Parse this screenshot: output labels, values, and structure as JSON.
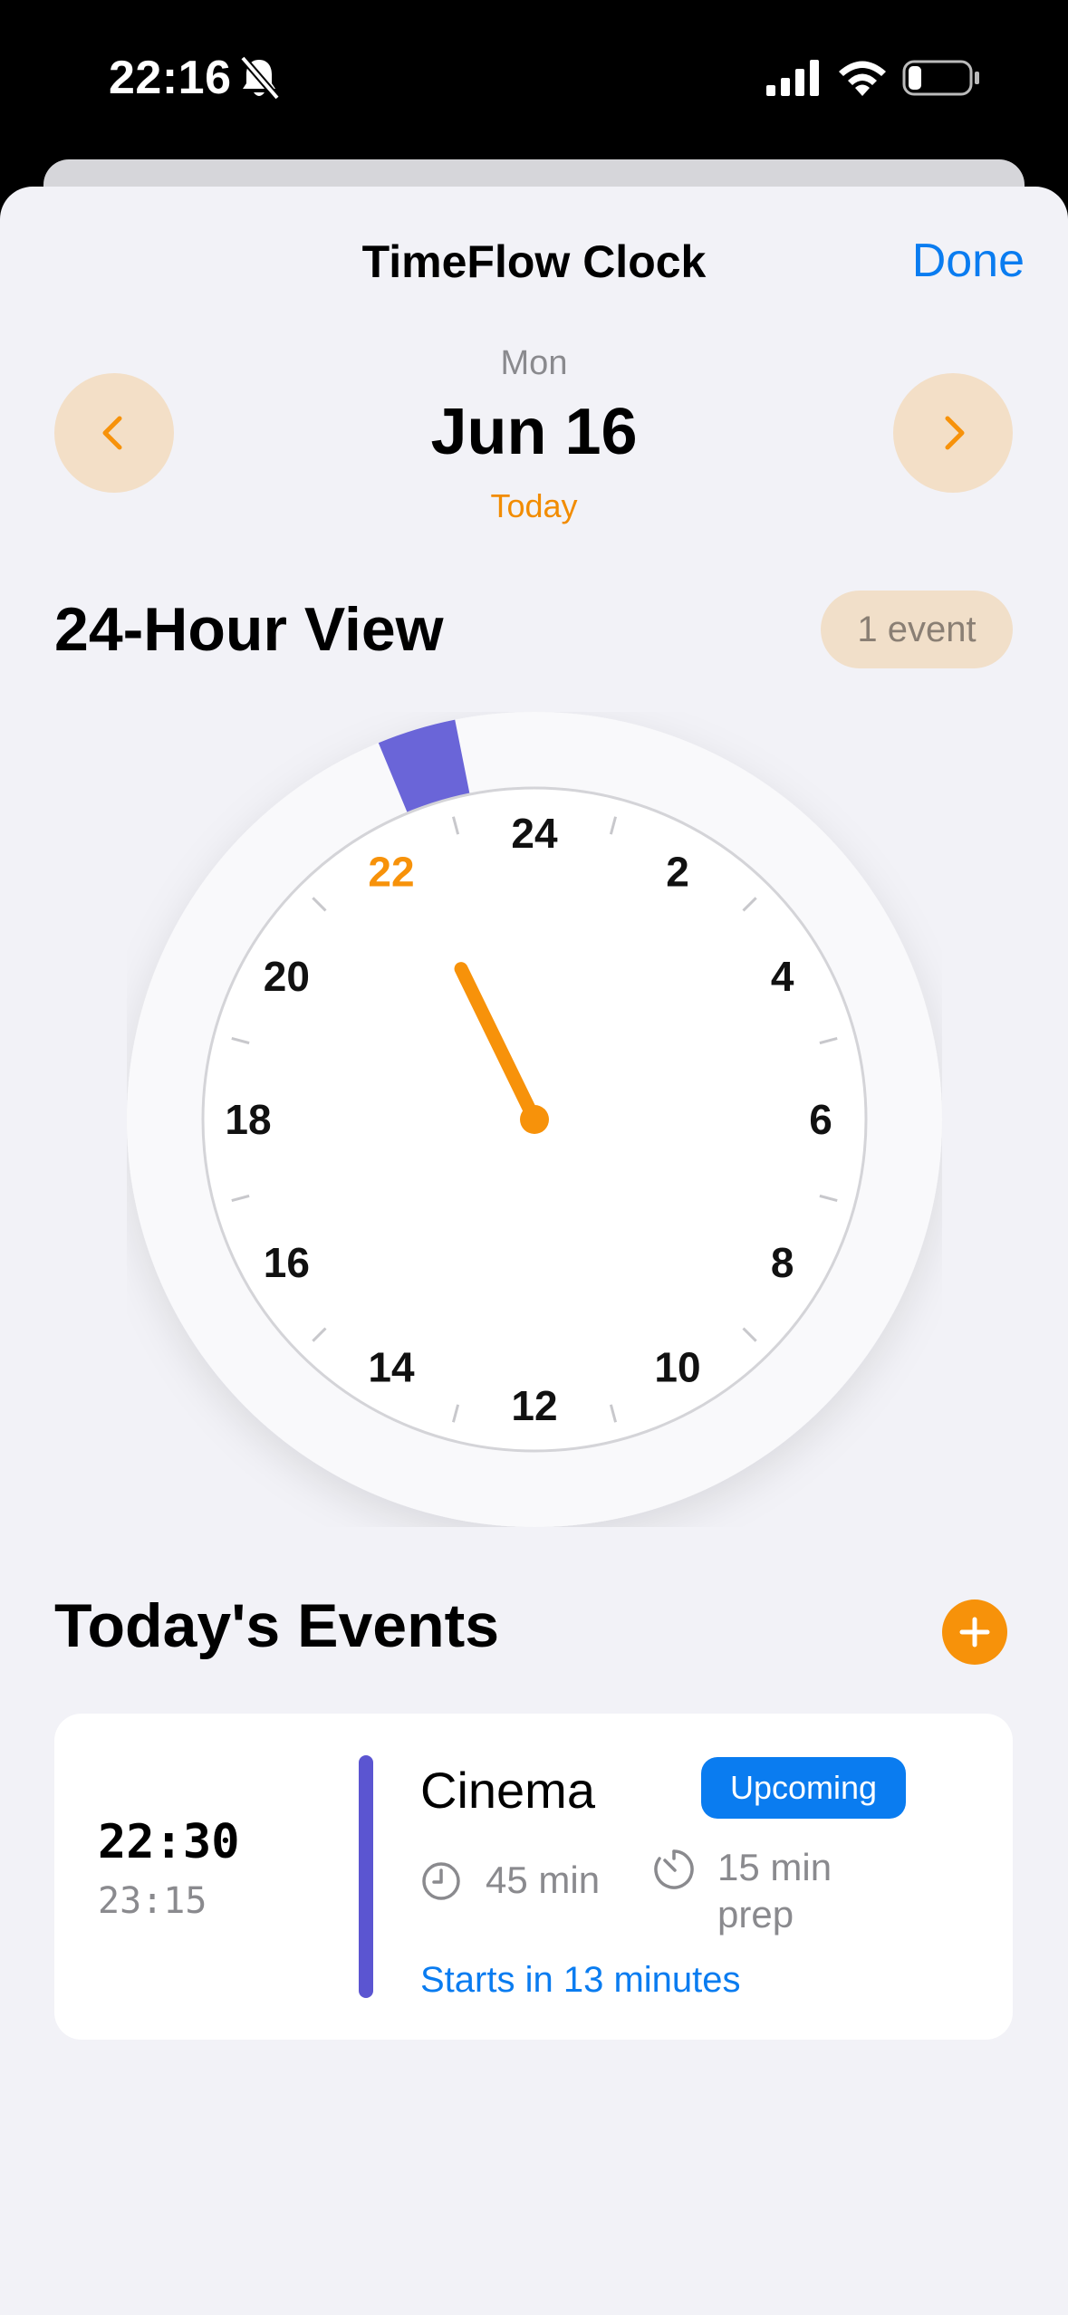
{
  "status_bar": {
    "time": "22:16",
    "icons": [
      "bell-slash-icon",
      "cellular-signal-icon",
      "wifi-icon",
      "battery-icon"
    ]
  },
  "nav": {
    "title": "TimeFlow Clock",
    "done_label": "Done"
  },
  "date_nav": {
    "day_of_week": "Mon",
    "date": "Jun 16",
    "relative": "Today",
    "prev_icon": "chevron-left-icon",
    "next_icon": "chevron-right-icon"
  },
  "clock_section": {
    "title": "24-Hour View",
    "event_count": "1 event",
    "hour_labels": [
      "24",
      "2",
      "4",
      "6",
      "8",
      "10",
      "12",
      "14",
      "16",
      "18",
      "20",
      "22"
    ],
    "highlighted_hour": "22",
    "current_time_hours": 22.27,
    "event_arc": {
      "start_hours": 22.5,
      "end_hours": 23.25,
      "color": "#6a65d8"
    }
  },
  "events_section": {
    "title": "Today's Events",
    "add_icon": "plus-icon",
    "events": [
      {
        "start": "22:30",
        "end": "23:15",
        "name": "Cinema",
        "status": "Upcoming",
        "duration": "45 min",
        "prep": "15 min prep",
        "starts_in": "Starts in 13 minutes",
        "color": "#5b55d1"
      }
    ]
  },
  "colors": {
    "accent": "#f7920a",
    "link": "#0a7cf0",
    "background": "#f2f2f7"
  }
}
